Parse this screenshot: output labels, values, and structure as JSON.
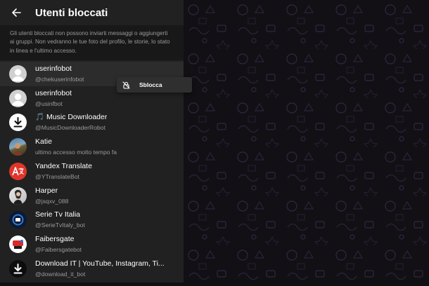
{
  "header": {
    "title": "Utenti bloccati",
    "back_icon": "arrow-left-icon"
  },
  "note": {
    "text": "Gli utenti bloccati non possono inviarti messaggi o aggiungerti ai gruppi. Non vedranno le tue foto del profilo, le storie, lo stato in linea e l'ultimo accesso."
  },
  "blocked_users": [
    {
      "name": "userinfobot",
      "handle": "@chekuserinfobot",
      "avatar": "default-user-avatar"
    },
    {
      "name": "userinfobot",
      "handle": "@usinfbot",
      "avatar": "default-user-avatar"
    },
    {
      "name": "🎵 Music Downloader",
      "handle": "@MusicDownloaderRobot",
      "avatar": "download-icon-avatar"
    },
    {
      "name": "Katie",
      "handle": "ultimo accesso molto tempo fa",
      "avatar": "photo-avatar"
    },
    {
      "name": "Yandex Translate",
      "handle": "@YTranslateBot",
      "avatar": "translate-icon-avatar"
    },
    {
      "name": "Harper",
      "handle": "@jsqxv_088",
      "avatar": "photo-avatar"
    },
    {
      "name": "Serie Tv Italia",
      "handle": "@SerieTvItaly_bot",
      "avatar": "logo-avatar"
    },
    {
      "name": "Faibersgate",
      "handle": "@Faibersgatebot",
      "avatar": "logo-avatar"
    },
    {
      "name": "Download IT | YouTube, Instagram, Ti...",
      "handle": "@download_it_bot",
      "avatar": "download-icon-avatar"
    }
  ],
  "context_menu": {
    "label": "Sblocca",
    "icon": "unblock-icon"
  },
  "colors": {
    "sidebar": "#212121",
    "note_bg": "#181818",
    "chat_bg": "#121015",
    "menu_bg": "#2f2f2f",
    "active_row": "#2c2c2c"
  }
}
